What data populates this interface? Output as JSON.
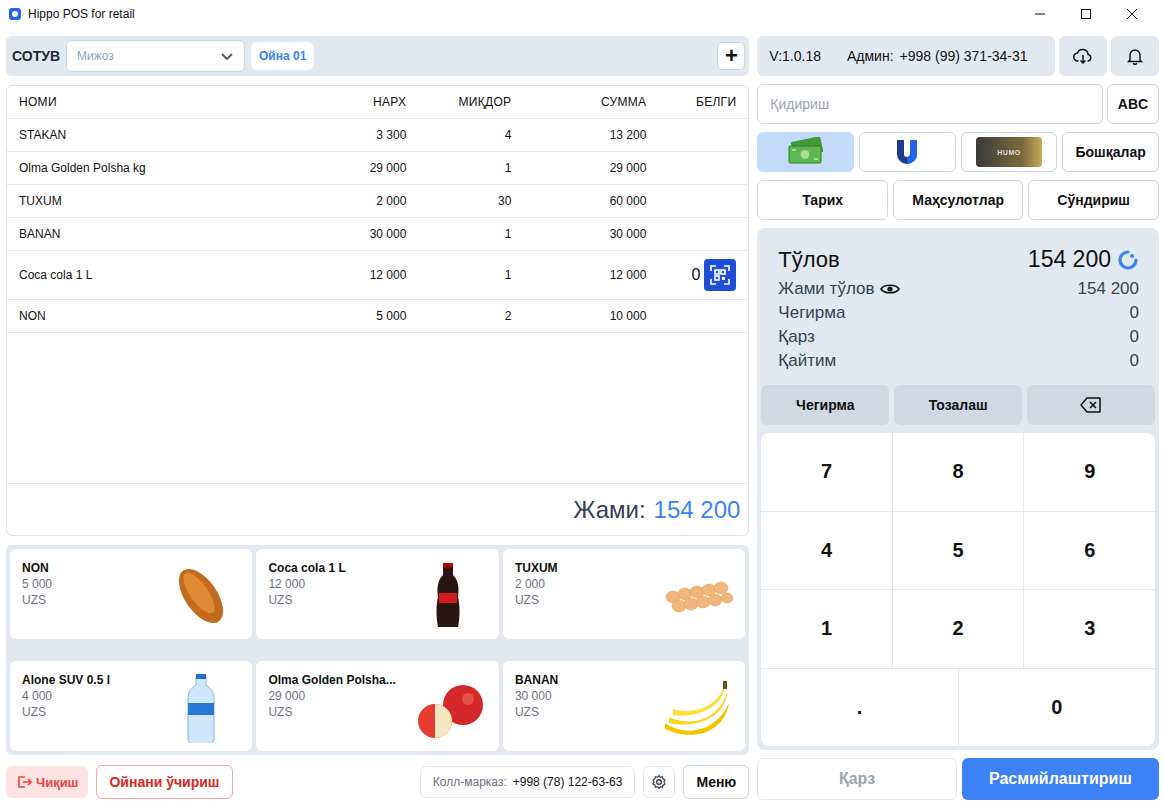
{
  "window": {
    "title": "Hippo POS for retail"
  },
  "sale_bar": {
    "label": "СОТУВ",
    "customer_placeholder": "Мижоз",
    "tabs": [
      {
        "label": "Ойна 01",
        "selected": true
      }
    ],
    "add": "+"
  },
  "table": {
    "columns": [
      "НОМИ",
      "НАРХ",
      "МИҚДОР",
      "СУММА",
      "БЕЛГИ"
    ],
    "rows": [
      {
        "cells": [
          "STAKAN",
          "3 300",
          "4",
          "13 200"
        ],
        "code": null
      },
      {
        "cells": [
          "Olma Golden Polsha kg",
          "29 000",
          "1",
          "29 000"
        ],
        "code": null
      },
      {
        "cells": [
          "TUXUM",
          "2 000",
          "30",
          "60 000"
        ],
        "code": null
      },
      {
        "cells": [
          "BANAN",
          "30 000",
          "1",
          "30 000"
        ],
        "code": null
      },
      {
        "cells": [
          "Coca cola 1 L",
          "12 000",
          "1",
          "12 000"
        ],
        "code": {
          "count": "0"
        }
      },
      {
        "cells": [
          "NON",
          "5 000",
          "2",
          "10 000"
        ],
        "code": null
      }
    ],
    "total_label": "Жами:",
    "total": "154 200"
  },
  "products": [
    {
      "name": "NON",
      "price": "5 000",
      "currency": "UZS",
      "kind": "bread"
    },
    {
      "name": "Coca cola 1 L",
      "price": "12 000",
      "currency": "UZS",
      "kind": "cola"
    },
    {
      "name": "TUXUM",
      "price": "2 000",
      "currency": "UZS",
      "kind": "eggs"
    },
    {
      "name": "Alone SUV 0.5 l",
      "price": "4 000",
      "currency": "UZS",
      "kind": "water"
    },
    {
      "name": "Olma Golden Polsha...",
      "price": "29 000",
      "currency": "UZS",
      "kind": "apple"
    },
    {
      "name": "BANAN",
      "price": "30 000",
      "currency": "UZS",
      "kind": "banana"
    }
  ],
  "footer": {
    "exit": "Чиқиш",
    "close_window": "Ойнани ўчириш",
    "call_center_label": "Колл-марказ:",
    "call_center_phone": "+998 (78) 122-63-63",
    "menu": "Меню"
  },
  "header": {
    "version": "V:1.0.18",
    "admin_label": "Админ:",
    "admin_phone": "+998 (99) 371-34-31"
  },
  "search": {
    "placeholder": "Қидириш",
    "keyboard": "ABC"
  },
  "payment_methods": [
    {
      "kind": "cash",
      "label": "",
      "selected": true
    },
    {
      "kind": "uzcard",
      "label": "",
      "selected": false
    },
    {
      "kind": "humo",
      "label": "HUMO",
      "selected": false
    },
    {
      "kind": "other",
      "label": "Бошқалар",
      "selected": false
    }
  ],
  "actions": [
    "Тарих",
    "Маҳсулотлар",
    "Сўндириш"
  ],
  "summary": {
    "total_label": "Тўлов",
    "total": "154 200",
    "rows": [
      {
        "label": "Жами тўлов",
        "value": "154 200",
        "kind": "eye"
      },
      {
        "label": "Чегирма",
        "value": "0",
        "kind": "plain"
      },
      {
        "label": "Қарз",
        "value": "0",
        "kind": "plain"
      },
      {
        "label": "Қайтим",
        "value": "0",
        "kind": "plain"
      }
    ]
  },
  "keypad": {
    "tools": [
      "Чегирма",
      "Тозалаш"
    ],
    "rows": [
      [
        "7",
        "8",
        "9"
      ],
      [
        "4",
        "5",
        "6"
      ],
      [
        "1",
        "2",
        "3"
      ],
      [
        ".",
        "0"
      ]
    ]
  },
  "bottom": {
    "debt": {
      "label": "Қарз",
      "disabled": true
    },
    "submit": "Расмийлаштириш"
  }
}
